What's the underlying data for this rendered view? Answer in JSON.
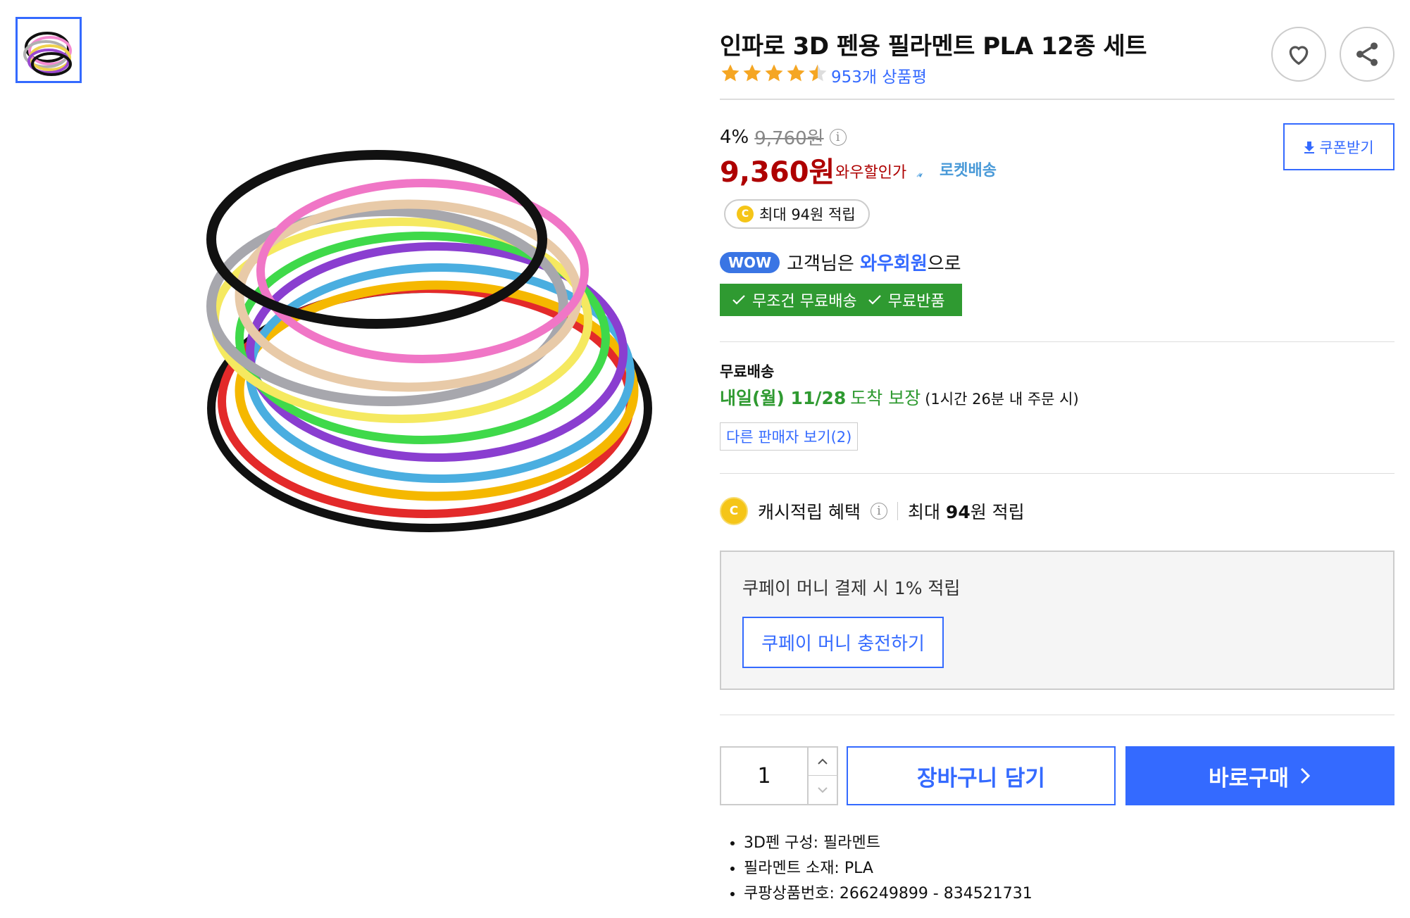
{
  "product": {
    "title": "인파로 3D 펜용 필라멘트 PLA 12종 세트",
    "rating_stars": 4.5,
    "review_count_label": "953개 상품평"
  },
  "price": {
    "discount_rate": "4%",
    "original_price": "9,760원",
    "sale_price": "9,360원",
    "wow_price_label": "와우할인가",
    "rocket_label": "로켓배송",
    "coupon_label": "쿠폰받기",
    "reward_pill": "최대 94원 적립"
  },
  "wow": {
    "badge": "WOW",
    "prefix": "고객님은",
    "member": "와우회원",
    "suffix": "으로",
    "benefit1": "무조건 무료배송",
    "benefit2": "무료반품"
  },
  "shipping": {
    "heading": "무료배송",
    "date": "내일(월) 11/28",
    "arrive": "도착 보장",
    "note": "(1시간 26분 내 주문 시)",
    "other_sellers": "다른 판매자 보기(2)"
  },
  "cash": {
    "label": "캐시적립 혜택",
    "prefix": "최대",
    "amount": "94",
    "suffix": "원 적립"
  },
  "coupay": {
    "text": "쿠페이 머니 결제 시 1% 적립",
    "button": "쿠페이 머니 충전하기"
  },
  "purchase": {
    "quantity": "1",
    "cart_label": "장바구니 담기",
    "buy_label": "바로구매"
  },
  "specs": [
    "3D펜 구성: 필라멘트",
    "필라멘트 소재: PLA",
    "쿠팡상품번호: 266249899 - 834521731"
  ],
  "icons": {
    "coin_letter": "C",
    "info": "i"
  },
  "colors": {
    "accent": "#346aff",
    "price_red": "#ae0000",
    "green": "#2f9a31",
    "star": "#f5a623"
  }
}
